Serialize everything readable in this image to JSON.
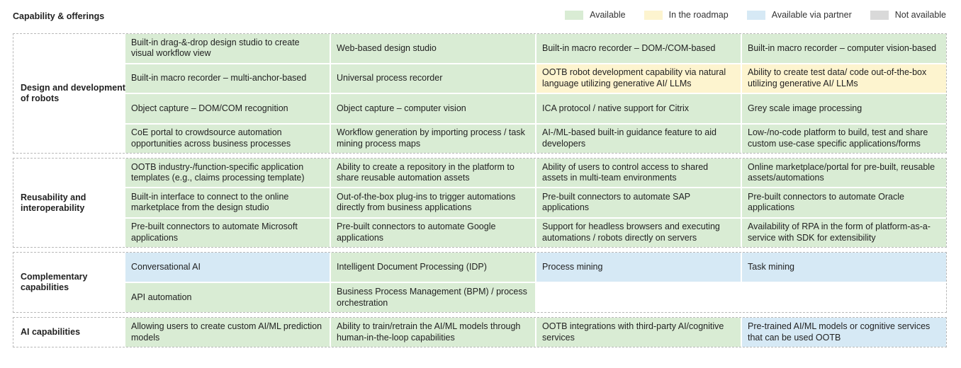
{
  "title": "Capability & offerings",
  "legend": [
    {
      "label": "Available",
      "color": "#d9ecd4"
    },
    {
      "label": "In the roadmap",
      "color": "#fdf4cf"
    },
    {
      "label": "Available via partner",
      "color": "#d6e9f5"
    },
    {
      "label": "Not available",
      "color": "#d9d9d9"
    }
  ],
  "sections": [
    {
      "label": "Design and development of robots",
      "rows": [
        [
          "Built-in drag-&-drop design studio to create visual workflow view",
          "Web-based design studio",
          "Built-in macro recorder – DOM-/COM-based",
          "Built-in macro recorder – computer vision-based"
        ],
        [
          "Built-in macro recorder – multi-anchor-based",
          "Universal process recorder",
          "OOTB robot development capability via natural language utilizing generative AI/ LLMs",
          "Ability to create test data/ code out-of-the-box utilizing generative AI/ LLMs"
        ],
        [
          "Object capture – DOM/COM recognition",
          "Object capture – computer vision",
          "ICA protocol / native support for Citrix",
          "Grey scale image processing"
        ],
        [
          "CoE portal to crowdsource automation opportunities across business processes",
          "Workflow generation by importing process / task mining process maps",
          "AI-/ML-based built-in guidance feature to aid developers",
          "Low-/no-code platform to build, test and share custom use-case specific applications/forms"
        ]
      ]
    },
    {
      "label": "Reusability and interoperability",
      "rows": [
        [
          "OOTB industry-/function-specific application templates (e.g., claims processing template)",
          "Ability to create a repository in the platform to share reusable automation assets",
          "Ability of users to control access to shared assets in multi-team environments",
          "Online marketplace/portal for pre-built, reusable assets/automations"
        ],
        [
          "Built-in interface to connect to the online marketplace from the design studio",
          "Out-of-the-box plug-ins to trigger automations directly from business applications",
          "Pre-built connectors to automate SAP applications",
          "Pre-built connectors to automate Oracle applications"
        ],
        [
          "Pre-built connectors to automate Microsoft applications",
          "Pre-built connectors to automate Google applications",
          "Support for headless browsers and executing automations / robots directly on servers",
          "Availability of RPA in the form of platform-as-a-service with SDK for extensibility"
        ]
      ]
    },
    {
      "label": "Complementary capabilities",
      "rows": [
        [
          "Conversational AI",
          "Intelligent Document Processing (IDP)",
          "Process mining",
          "Task mining"
        ],
        [
          "API automation",
          "Business Process Management (BPM) / process orchestration",
          "",
          ""
        ]
      ]
    },
    {
      "label": "AI capabilities",
      "rows": [
        [
          "Allowing users to create custom AI/ML prediction models",
          "Ability to train/retrain the AI/ML models through human-in-the-loop capabilities",
          "OOTB integrations with third-party AI/cognitive services",
          "Pre-trained AI/ML models or cognitive services that can be used OOTB"
        ]
      ]
    }
  ]
}
